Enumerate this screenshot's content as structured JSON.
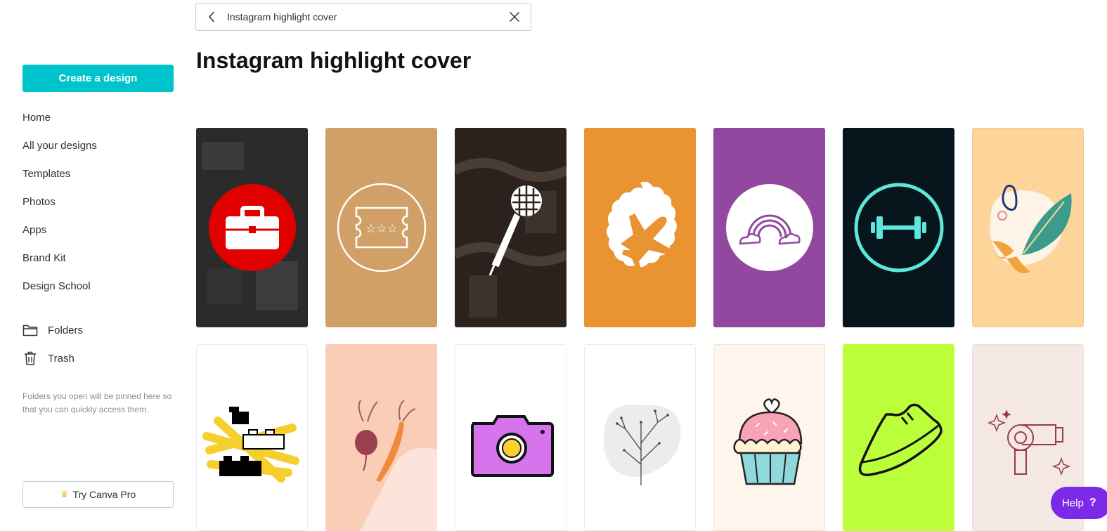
{
  "sidebar": {
    "create_label": "Create a design",
    "nav": [
      "Home",
      "All your designs",
      "Templates",
      "Photos",
      "Apps",
      "Brand Kit",
      "Design School"
    ],
    "folders_label": "Folders",
    "trash_label": "Trash",
    "hint": "Folders you open will be pinned here so that you can quickly access them.",
    "pro_label": "Try Canva Pro"
  },
  "search": {
    "value": "Instagram highlight cover"
  },
  "page_title": "Instagram highlight cover",
  "help": {
    "label": "Help",
    "mark": "?"
  },
  "templates": [
    {
      "icon": "briefcase-icon",
      "bg": "#2b2b2b"
    },
    {
      "icon": "ticket-icon",
      "bg": "#d0a067"
    },
    {
      "icon": "microphone-icon",
      "bg": "#2c221d"
    },
    {
      "icon": "airplane-icon",
      "bg": "#e99331"
    },
    {
      "icon": "rainbow-icon",
      "bg": "#91489e"
    },
    {
      "icon": "dumbbell-icon",
      "bg": "#06161c"
    },
    {
      "icon": "leaf-icon",
      "bg": "#fdd59a"
    },
    {
      "icon": "blocks-icon",
      "bg": "#ffffff"
    },
    {
      "icon": "vegetables-icon",
      "bg": "#fde4da"
    },
    {
      "icon": "camera-icon",
      "bg": "#ffffff"
    },
    {
      "icon": "plant-icon",
      "bg": "#ffffff"
    },
    {
      "icon": "cupcake-icon",
      "bg": "#fef5ec"
    },
    {
      "icon": "sneaker-icon",
      "bg": "#bbfe3a"
    },
    {
      "icon": "hairdryer-icon",
      "bg": "#f4e8e4"
    }
  ]
}
